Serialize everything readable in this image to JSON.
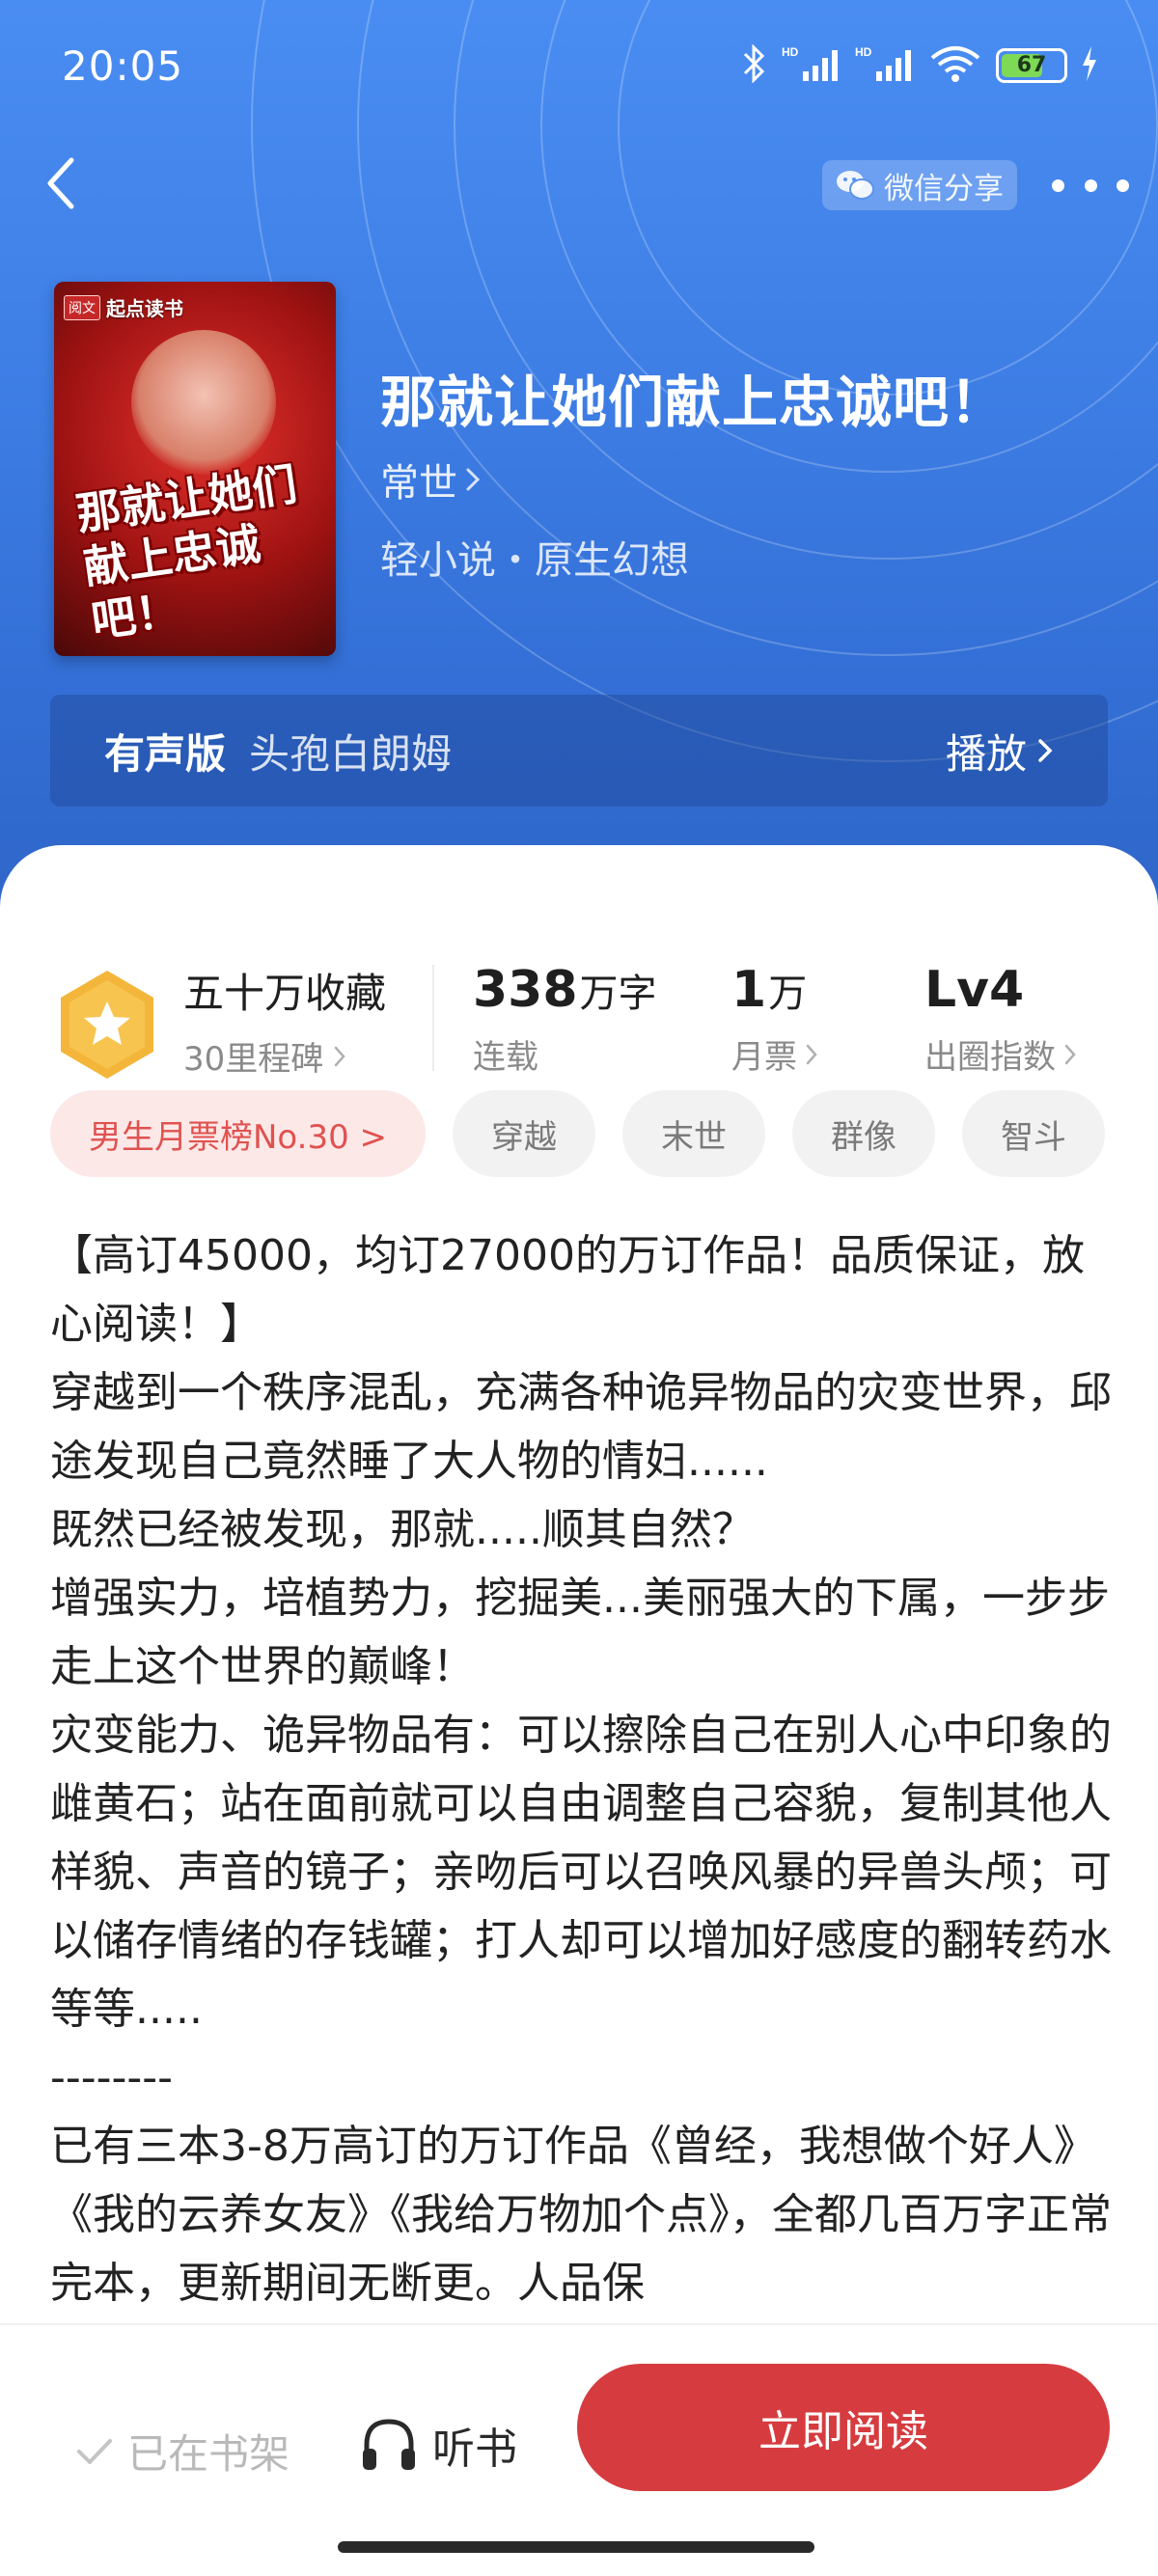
{
  "status_bar": {
    "time": "20:05",
    "battery": "67"
  },
  "header": {
    "share_label": "微信分享"
  },
  "book": {
    "cover_brand": "起点读书",
    "cover_badge": "阅文",
    "cover_title": "那就让她们献上忠诚吧！",
    "title": "那就让她们献上忠诚吧！",
    "author": "常世",
    "genre": "轻小说・原生幻想"
  },
  "audio": {
    "label": "有声版",
    "narrator": "头孢白朗姆",
    "play_label": "播放"
  },
  "stats": {
    "collection_main": "五十万收藏",
    "collection_sub": "30里程碑",
    "words_value": "338",
    "words_unit": "万字",
    "words_label": "连载",
    "tickets_value": "1",
    "tickets_unit": "万",
    "tickets_label": "月票",
    "influence_value": "Lv4",
    "influence_label": "出圈指数"
  },
  "tags": [
    "男生月票榜No.30 >",
    "穿越",
    "末世",
    "群像",
    "智斗"
  ],
  "description": [
    "【高订45000，均订27000的万订作品！品质保证，放心阅读！】",
    "穿越到一个秩序混乱，充满各种诡异物品的灾变世界，邱途发现自己竟然睡了大人物的情妇......",
    "既然已经被发现，那就.....顺其自然？",
    "增强实力，培植势力，挖掘美...美丽强大的下属，一步步走上这个世界的巅峰！",
    "灾变能力、诡异物品有：可以擦除自己在别人心中印象的雌黄石；站在面前就可以自由调整自己容貌，复制其他人样貌、声音的镜子；亲吻后可以召唤风暴的异兽头颅；可以储存情绪的存钱罐；打人却可以增加好感度的翻转药水等等.....",
    "--------",
    "已有三本3-8万高订的万订作品《曾经，我想做个好人》《我的云养女友》《我给万物加个点》，全都几百万字正常完本，更新期间无断更。人品保"
  ],
  "actions": {
    "shelf_label": "已在书架",
    "listen_label": "听书",
    "read_label": "立即阅读"
  },
  "colors": {
    "header_blue": "#3e7fe6",
    "read_button": "#d63c3f",
    "rank_tag_bg": "#fde8e8",
    "rank_tag_text": "#e0524f"
  }
}
